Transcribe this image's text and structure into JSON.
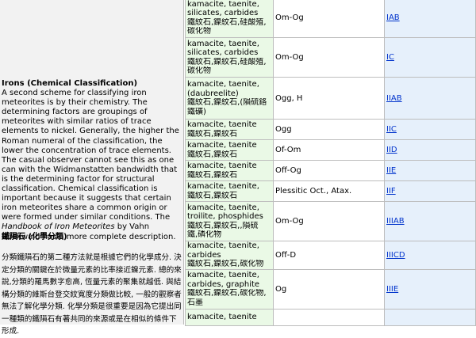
{
  "left": {
    "heading": "Irons (Chemical Classification)",
    "paragraph_before_em": "A second scheme for classifying iron meteorites is by their chemistry. The determining factors are groupings of meteorites with similar ratios of trace elements to nickel. Generally, the higher the Roman numeral of the classification, the lower the concentration of trace elements. The casual observer cannot see this as one can with the Widmanstatten bandwidth that is the determining factor for structural classification. Chemical classification is important because it suggests that certain iron meteorites share a common origin or were formed under similar conditions. The ",
    "paragraph_em": "Handbook of Iron Meteorites",
    "paragraph_after_em": " by Vahn Buchwald has a more complete description.",
    "zh_heading": "鐵隕石 (化學分類)",
    "zh_paragraph": "分類鐵隕石的第二種方法就是根據它們的化學成分. 決定分類的關鍵在於微量元素的比率接近鎳元素. 總的來說,分類的羅馬數字愈高, 恆量元素的聚集就越低. 與結構分類的維斯台登交紋寬度分類做比較, 一般的觀察者無法了解化學分類. 化學分類是很重要是因為它提出同一種類的鐵隕石有著共同的來源或是在相似的條件下形成."
  },
  "table": {
    "rows": [
      {
        "mat": [
          "kamacite, taenite,",
          "silicates, carbides",
          "鐵紋石,鎳紋石,硅酸殖,",
          "碳化物"
        ],
        "grp": "Om-Og",
        "cls": "IAB"
      },
      {
        "mat": [
          "kamacite, taenite,",
          "silicates, carbides",
          "鐵紋石,鎳紋石,硅酸殖,",
          "碳化物"
        ],
        "grp": "Om-Og",
        "cls": "IC"
      },
      {
        "mat": [
          "kamacite, taenite,",
          "(daubreelite)",
          "鐵紋石,鎳紋石,(隕硫鉻",
          "鐵礦)"
        ],
        "grp": "Ogg, H",
        "cls": "IIAB"
      },
      {
        "mat": [
          "kamacite, taenite",
          "鐵紋石,鎳紋石"
        ],
        "grp": "Ogg",
        "cls": "IIC"
      },
      {
        "mat": [
          "kamacite, taenite",
          "鐵紋石,鎳紋石"
        ],
        "grp": "Of-Om",
        "cls": "IID"
      },
      {
        "mat": [
          "kamacite, taenite",
          "鐵紋石,鎳紋石"
        ],
        "grp": "Off-Og",
        "cls": "IIE"
      },
      {
        "mat": [
          "kamacite, taenite,",
          "鐵紋石,鎳紋石"
        ],
        "grp": "Plessitic Oct., Atax.",
        "cls": "IIF"
      },
      {
        "mat": [
          "kamacite, taenite,",
          "troilite, phosphides",
          "鐵紋石,鎳紋石,,隕硫",
          "鐵,磷化物"
        ],
        "grp": "Om-Og",
        "cls": "IIIAB"
      },
      {
        "mat": [
          "kamacite, taenite,",
          "carbides",
          "鐵紋石,鎳紋石,碳化物"
        ],
        "grp": "Off-D",
        "cls": "IIICD"
      },
      {
        "mat": [
          "kamacite, taenite,",
          "carbides, graphite",
          "鐵紋石,鎳紋石,碳化物,",
          "石墨"
        ],
        "grp": "Og",
        "cls": "IIIE"
      },
      {
        "mat": [
          "kamacite, taenite"
        ],
        "grp": "",
        "cls": ""
      }
    ]
  }
}
